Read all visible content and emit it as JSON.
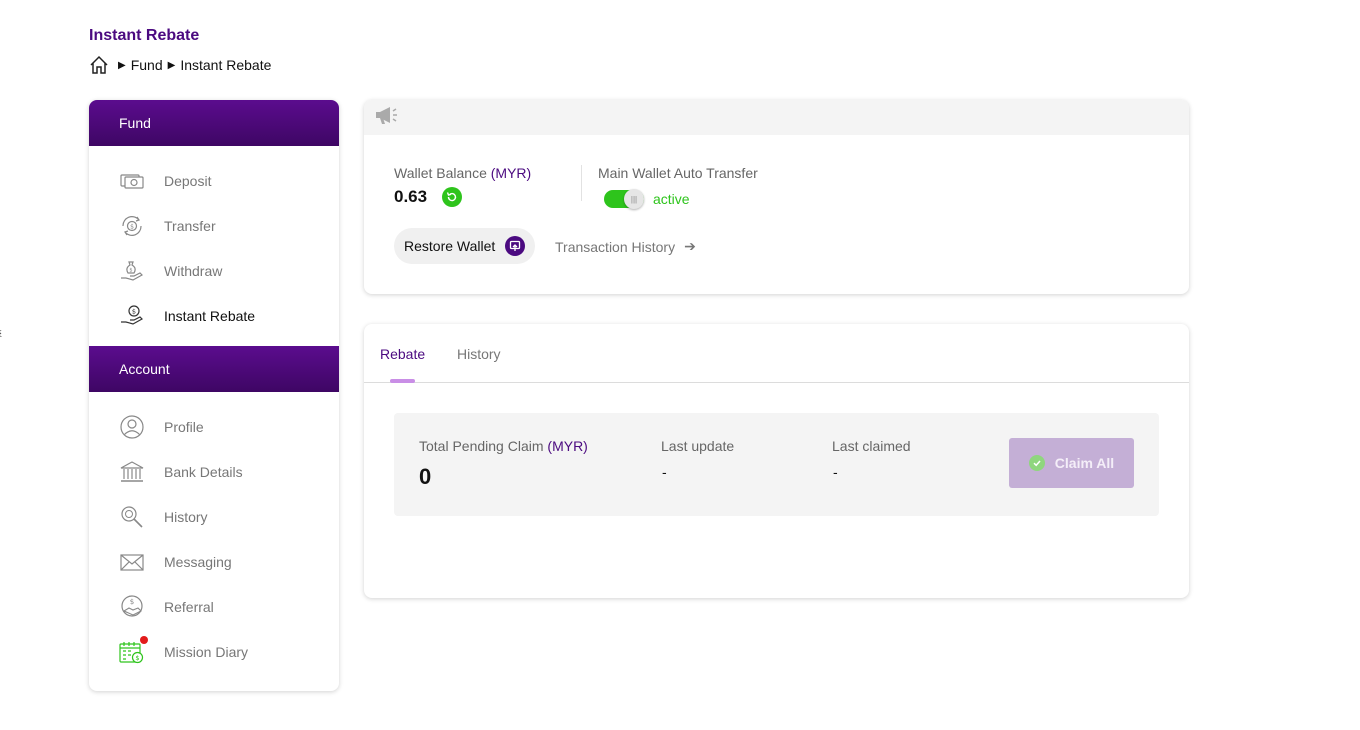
{
  "page": {
    "title": "Instant Rebate"
  },
  "breadcrumb": {
    "items": [
      "Fund",
      "Instant Rebate"
    ],
    "sep": "▶"
  },
  "stray_glyph": "ଽ",
  "sidebar": {
    "sections": [
      {
        "title": "Fund",
        "items": [
          {
            "label": "Deposit",
            "icon": "deposit-icon"
          },
          {
            "label": "Transfer",
            "icon": "transfer-icon"
          },
          {
            "label": "Withdraw",
            "icon": "withdraw-icon"
          },
          {
            "label": "Instant Rebate",
            "icon": "instant-rebate-icon",
            "active": true
          }
        ]
      },
      {
        "title": "Account",
        "items": [
          {
            "label": "Profile",
            "icon": "profile-icon"
          },
          {
            "label": "Bank Details",
            "icon": "bank-icon"
          },
          {
            "label": "History",
            "icon": "history-icon"
          },
          {
            "label": "Messaging",
            "icon": "envelope-icon"
          },
          {
            "label": "Referral",
            "icon": "referral-icon"
          },
          {
            "label": "Mission Diary",
            "icon": "calendar-money-icon",
            "badge": "red-dot"
          }
        ]
      }
    ]
  },
  "wallet": {
    "balance_label": "Wallet Balance",
    "currency": "(MYR)",
    "balance": "0.63",
    "auto_transfer_label": "Main Wallet Auto Transfer",
    "auto_transfer_on": true,
    "auto_transfer_status": "active",
    "restore_label": "Restore Wallet",
    "history_link": "Transaction History"
  },
  "rebate": {
    "tabs": [
      "Rebate",
      "History"
    ],
    "active_tab": "Rebate",
    "total_label": "Total Pending Claim",
    "currency": "(MYR)",
    "total_value": "0",
    "last_update_label": "Last update",
    "last_update_value": "-",
    "last_claimed_label": "Last claimed",
    "last_claimed_value": "-",
    "claim_button": "Claim All"
  },
  "colors": {
    "brand_purple": "#4b0a80",
    "success_green": "#2ec41c",
    "claim_disabled": "#c4afd6",
    "tab_underline": "#c98ee6"
  }
}
